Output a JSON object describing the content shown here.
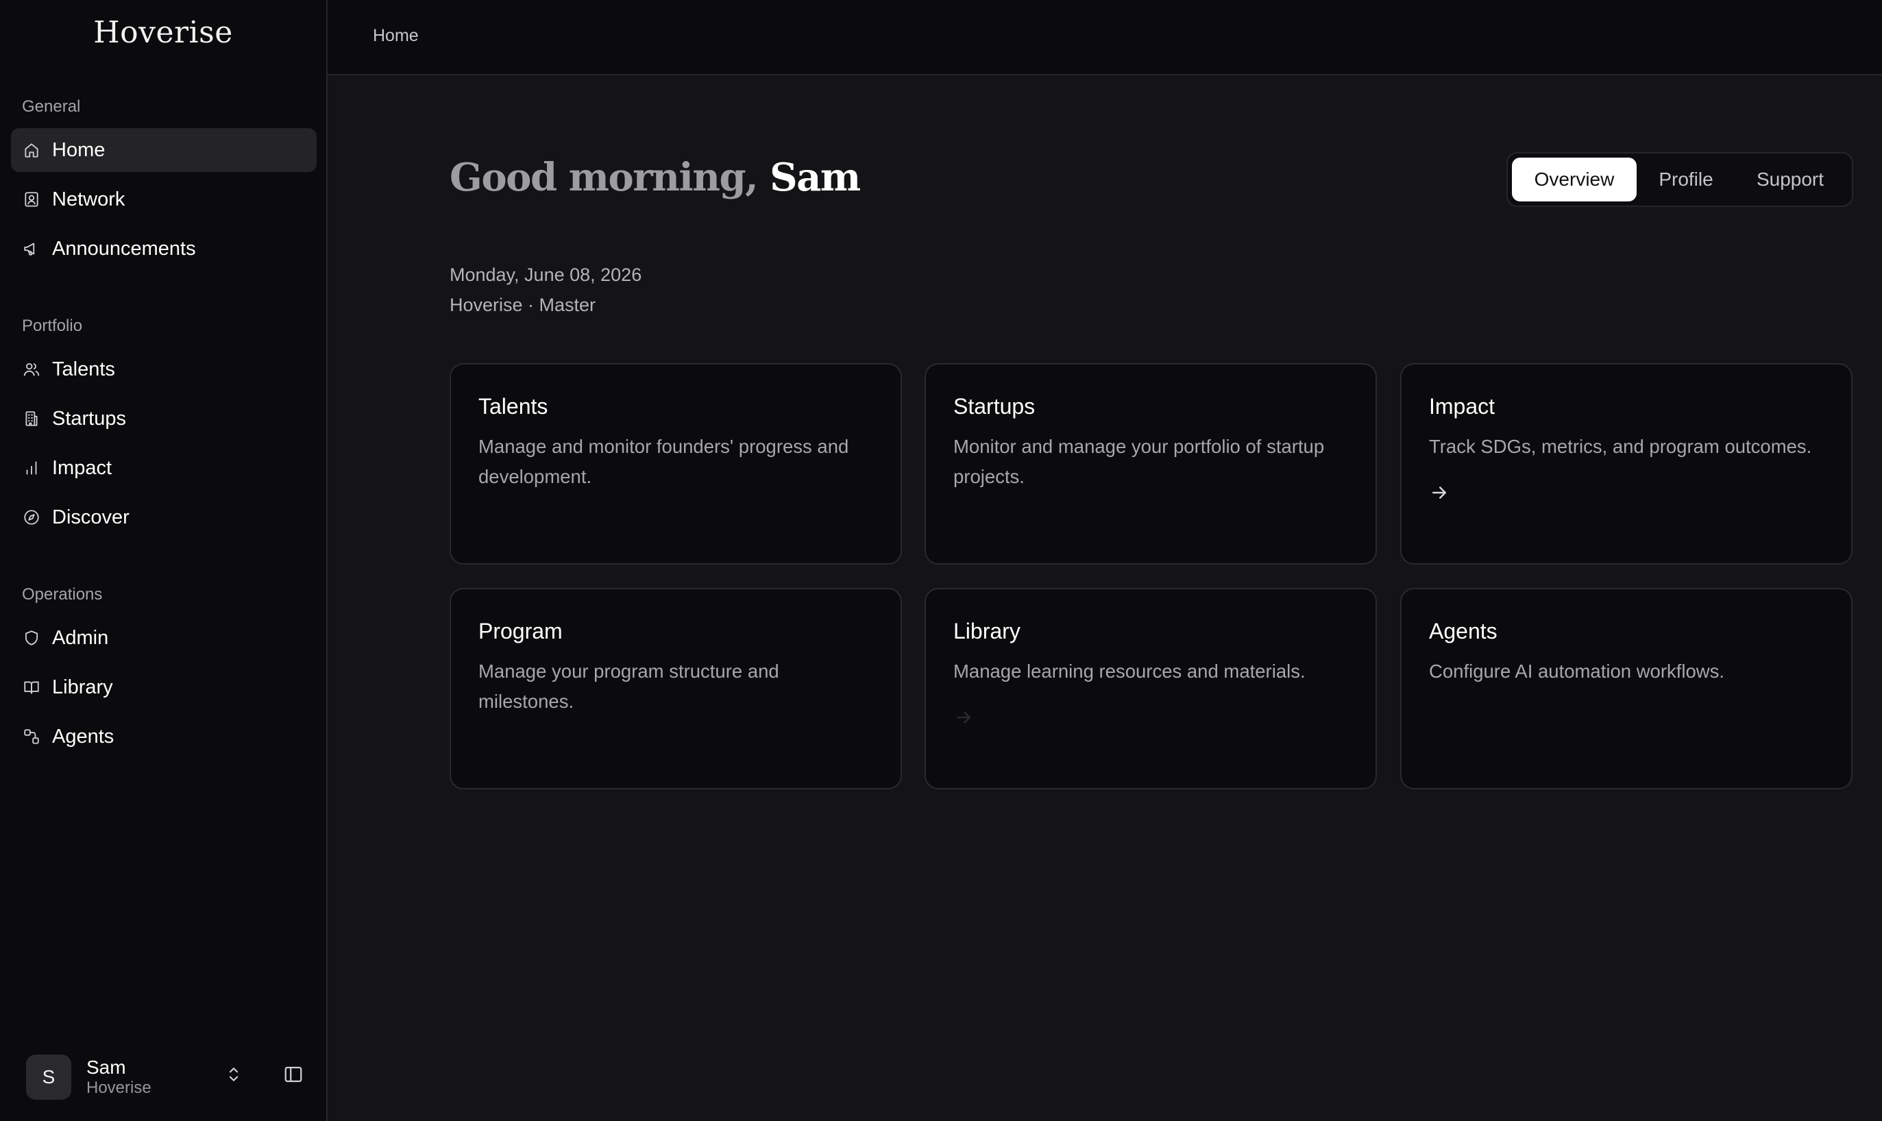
{
  "app": {
    "brand": "Hoverise"
  },
  "sidebar": {
    "sections": [
      {
        "label": "General"
      },
      {
        "label": "Portfolio"
      },
      {
        "label": "Operations"
      }
    ],
    "items": [
      {
        "label": "Home",
        "icon": "home-icon",
        "active": true
      },
      {
        "label": "Network",
        "icon": "contact-card-icon"
      },
      {
        "label": "Announcements",
        "icon": "megaphone-icon"
      },
      {
        "label": "Talents",
        "icon": "users-icon"
      },
      {
        "label": "Startups",
        "icon": "building-icon"
      },
      {
        "label": "Impact",
        "icon": "bar-chart-icon"
      },
      {
        "label": "Discover",
        "icon": "compass-icon"
      },
      {
        "label": "Admin",
        "icon": "shield-icon"
      },
      {
        "label": "Library",
        "icon": "book-open-icon"
      },
      {
        "label": "Agents",
        "icon": "workflow-icon"
      }
    ],
    "user": {
      "initial": "S",
      "name": "Sam",
      "org": "Hoverise"
    }
  },
  "header": {
    "breadcrumb": "Home"
  },
  "main": {
    "greeting_prefix": "Good morning,",
    "greeting_name": "Sam",
    "tabs": [
      {
        "label": "Overview",
        "active": true
      },
      {
        "label": "Profile"
      },
      {
        "label": "Support"
      }
    ],
    "date": "Monday, June 08, 2026",
    "org_line": "Hoverise · Master",
    "cards": [
      {
        "title": "Talents",
        "description": "Manage and monitor founders' progress and development."
      },
      {
        "title": "Startups",
        "description": "Monitor and manage your portfolio of startup projects."
      },
      {
        "title": "Impact",
        "description": "Track SDGs, metrics, and program outcomes.",
        "arrow": "arrow-right-icon"
      },
      {
        "title": "Program",
        "description": "Manage your program structure and milestones."
      },
      {
        "title": "Library",
        "description": "Manage learning resources and materials.",
        "arrow": "arrow-right-icon"
      },
      {
        "title": "Agents",
        "description": "Configure AI automation workflows."
      }
    ]
  },
  "colors": {
    "background": "#141416",
    "sidebar": "#0b0b0d",
    "card": "#0b0b0d",
    "active_item": "#242427",
    "muted_text": "#a7a7ac"
  }
}
